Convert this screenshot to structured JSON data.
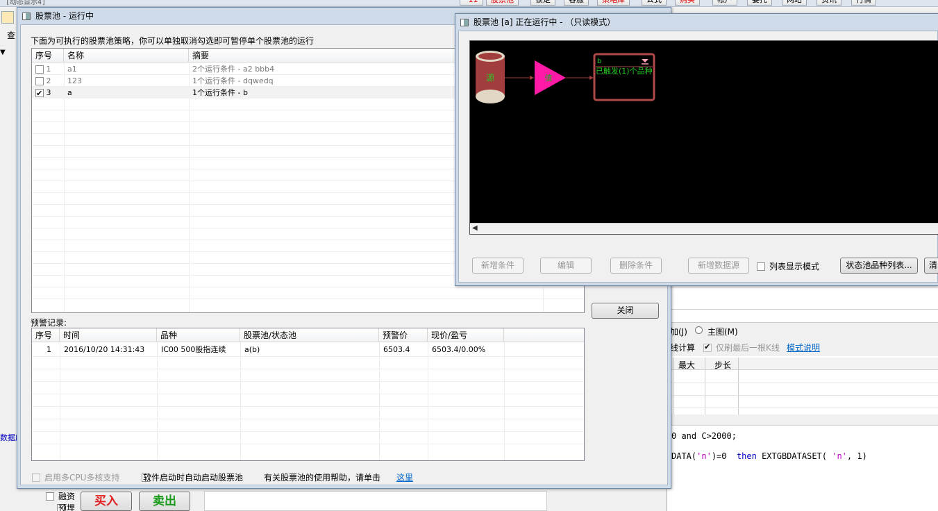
{
  "background": {
    "tab_title": "[动态显示4]",
    "top_buttons": [
      "*11",
      "股票池",
      "锁定",
      "客服",
      "策略库",
      "公式",
      "购买",
      "帐户",
      "委托",
      "网站",
      "资讯",
      "行情"
    ],
    "left_menu": "查",
    "left_frag": "数据库",
    "mode_row": {
      "add": "加(J)",
      "main_radio": "主图(M)",
      "calc": "线计算",
      "last_kline": "仅刷最后一根K线",
      "mode_link": "模式说明"
    },
    "param_headers": {
      "max": "最大",
      "step": "步长"
    },
    "code_line1": "0 and C>2000;",
    "code_line2_a": "DATA(",
    "code_line2_b": "'n'",
    "code_line2_c": ")=0  ",
    "code_line2_then": "then",
    "code_line2_d": " EXTGBDATASET( ",
    "code_line2_e": "'n'",
    "code_line2_f": ", 1)",
    "bottom_checks": {
      "margin": "融资",
      "hedge": "预埋"
    },
    "buy_label": "买入",
    "sell_label": "卖出"
  },
  "pool_window": {
    "title": "股票池  - 运行中",
    "instructions": "下面为可执行的股票池策略，你可以单独取消勾选即可暂停单个股票池的运行",
    "columns": {
      "index": "序号",
      "name": "名称",
      "summary": "摘要"
    },
    "rows": [
      {
        "checked": false,
        "index": "1",
        "name": "a1",
        "summary": "2个运行条件 - a2 bbb4",
        "dim": true
      },
      {
        "checked": false,
        "index": "2",
        "name": "123",
        "summary": "1个运行条件 - dqwedq",
        "dim": true
      },
      {
        "checked": true,
        "index": "3",
        "name": "a",
        "summary": "1个运行条件 - b",
        "dim": false
      }
    ],
    "close_label": "关闭",
    "alert_label": "预警记录:",
    "alert_columns": {
      "index": "序号",
      "time": "时间",
      "symbol": "品种",
      "pool": "股票池/状态池",
      "price": "预警价",
      "pnl": "现价/盈亏"
    },
    "alert_rows": [
      {
        "index": "1",
        "time": "2016/10/20 14:31:43",
        "symbol": "IC00 500股指连续",
        "pool": "a(b)",
        "price": "6503.4",
        "pnl": "6503.4/0.00%"
      }
    ],
    "multicore_label": "启用多CPU多核支持",
    "autostart_label": "软件启动时自动启动股票池",
    "help_text": "有关股票池的使用帮助，请单击",
    "help_link": "这里"
  },
  "flow_window": {
    "title": "股票池 [a] 正在运行中 - （只读模式）",
    "source_label": "源",
    "trigger_label": "值",
    "node_title": "b",
    "node_text": "已触发(1)个品种",
    "buttons": {
      "add_condition": "新增条件",
      "edit": "编辑",
      "delete_condition": "删除条件",
      "add_source": "新增数据源",
      "list_mode": "列表显示模式",
      "pool_list": "状态池品种列表...",
      "clear": "清"
    },
    "colors": {
      "node_border": "#b04a4a",
      "node_text": "#22cc22",
      "trigger": "#ff1aa6",
      "source": "#a23d3d",
      "canvas": "#000000"
    }
  }
}
